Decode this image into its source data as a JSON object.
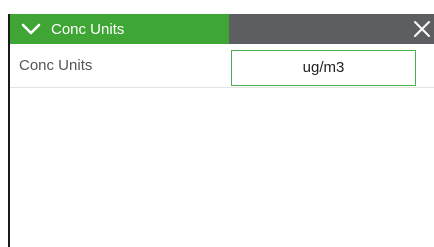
{
  "panel": {
    "title": "Conc Units",
    "close_icon": "close-icon",
    "collapse_icon": "chevron-down-icon"
  },
  "settings": {
    "rows": [
      {
        "label": "Conc Units",
        "value": "ug/m3"
      }
    ]
  },
  "colors": {
    "header_accent": "#3fa535",
    "header_dark": "#5d5e62",
    "value_border": "#4caf50"
  }
}
